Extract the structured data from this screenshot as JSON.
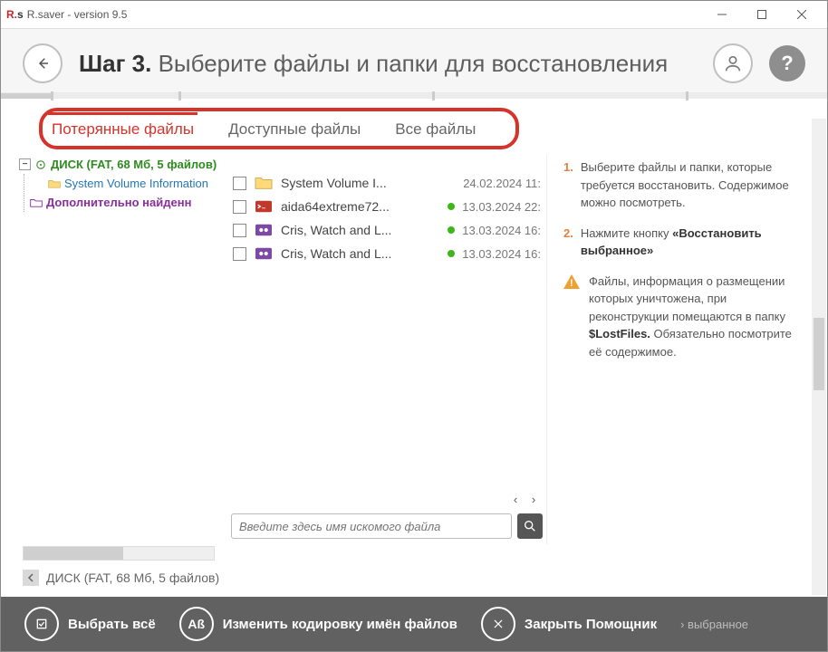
{
  "window": {
    "title": "R.saver - version 9.5"
  },
  "header": {
    "step_label": "Шаг 3.",
    "title_rest": "Выберите файлы и папки для восстановления"
  },
  "tabs": {
    "lost": "Потерянные файлы",
    "available": "Доступные файлы",
    "all": "Все файлы"
  },
  "tree": {
    "disk": "ДИСК (FAT, 68 Мб, 5 файлов)",
    "svi": "System Volume Information",
    "extra": "Дополнительно найденн"
  },
  "files": [
    {
      "name": "System Volume I...",
      "date": "24.02.2024 11:",
      "type": "folder",
      "dot": false
    },
    {
      "name": "aida64extreme72...",
      "date": "13.03.2024 22:",
      "type": "exe",
      "dot": true
    },
    {
      "name": "Cris, Watch and L...",
      "date": "13.03.2024 16:",
      "type": "media",
      "dot": true
    },
    {
      "name": "Cris, Watch and L...",
      "date": "13.03.2024 16:",
      "type": "media",
      "dot": true
    }
  ],
  "search": {
    "placeholder": "Введите здесь имя искомого файла"
  },
  "crumb": "ДИСК (FAT, 68 Мб, 5 файлов)",
  "hints": {
    "h1": "Выберите файлы и папки, которые требуется восстановить. Содержимое можно посмотреть.",
    "h2a": "Нажмите кнопку ",
    "h2b": "«Восстановить выбранное»",
    "warn_a": "Файлы, информация о размещении которых уничтожена, при реконструкции помещаются в папку ",
    "warn_b": "$LostFiles.",
    "warn_c": " Обязательно посмотрите её содержимое."
  },
  "footer": {
    "select_all": "Выбрать всё",
    "encoding": "Изменить кодировку имён файлов",
    "close": "Закрыть Помощник",
    "restore_fade": "› выбранное"
  }
}
